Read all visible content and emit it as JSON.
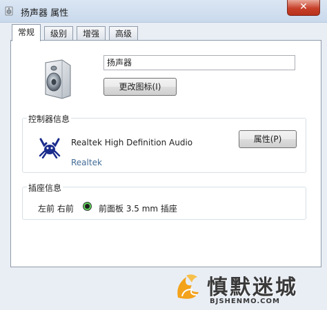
{
  "window": {
    "title": "扬声器 属性",
    "close_label": "✕"
  },
  "tabs": [
    {
      "label": "常规",
      "active": true
    },
    {
      "label": "级别"
    },
    {
      "label": "增强"
    },
    {
      "label": "高级"
    }
  ],
  "general": {
    "device_name": "扬声器",
    "change_icon_label": "更改图标(I)",
    "controller": {
      "legend": "控制器信息",
      "driver_name": "Realtek High Definition Audio",
      "vendor": "Realtek",
      "properties_label": "属性(P)"
    },
    "jack": {
      "legend": "插座信息",
      "position": "左前 右前",
      "description": "前面板 3.5 mm 插座",
      "color": "#5fd35a"
    }
  },
  "watermark": {
    "name": "慎默迷城",
    "url": "BJSHENMO.COM"
  }
}
